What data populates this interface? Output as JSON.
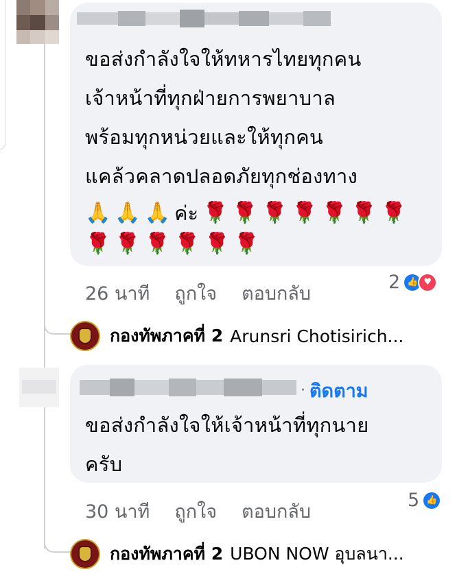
{
  "comment1": {
    "text": "ขอส่งกำลังใจให้ทหารไทยทุกคน\nเจ้าหน้าที่ทุกฝ่ายการพยาบาล\nพร้อมทุกหน่วยและให้ทุกคน\nแคล้วคลาดปลอดภัยทุกช่องทาง",
    "suffix": "ค่ะ",
    "emoji_pray": "🙏",
    "emoji_rose": "🌹",
    "time": "26 นาที",
    "like_label": "ถูกใจ",
    "reply_label": "ตอบกลับ",
    "reaction_count": "2",
    "reactions": [
      "like-icon",
      "love-icon"
    ]
  },
  "reply1": {
    "page_name": "กองทัพภาคที่ 2",
    "text": "Arunsri Chotisirich..."
  },
  "comment2": {
    "follow_label": "ติดตาม",
    "text": "ขอส่งกำลังใจให้เจ้าหน้าที่ทุกนาย\nครับ",
    "time": "30 นาที",
    "like_label": "ถูกใจ",
    "reply_label": "ตอบกลับ",
    "reaction_count": "5",
    "reactions": [
      "like-icon"
    ]
  },
  "reply2": {
    "page_name": "กองทัพภาคที่ 2",
    "text": "UBON NOW อุบลนา..."
  },
  "colors": {
    "bubble": "#f0f2f5",
    "link_blue": "#1877f2",
    "meta_gray": "#65676b",
    "like_blue": "#1877f2",
    "love_red": "#f33e58"
  }
}
